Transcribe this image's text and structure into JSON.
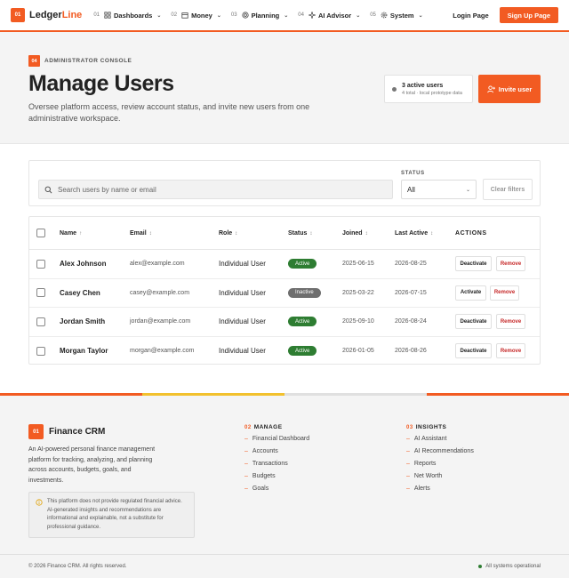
{
  "nav": {
    "logo_badge": "01",
    "logo_main": "Ledger",
    "logo_accent": "Line",
    "items": [
      {
        "num": "01",
        "label": "Dashboards",
        "icon": "grid-icon"
      },
      {
        "num": "02",
        "label": "Money",
        "icon": "calendar-icon"
      },
      {
        "num": "03",
        "label": "Planning",
        "icon": "target-icon"
      },
      {
        "num": "04",
        "label": "AI Advisor",
        "icon": "sparkle-icon"
      },
      {
        "num": "05",
        "label": "System",
        "icon": "gear-icon"
      }
    ],
    "login_label": "Login Page",
    "signup_label": "Sign Up Page"
  },
  "hero": {
    "eyebrow_badge": "04",
    "eyebrow": "ADMINISTRATOR CONSOLE",
    "title": "Manage Users",
    "subtitle": "Oversee platform access, review account status, and invite new users from one administrative workspace.",
    "stat_title": "3 active users",
    "stat_sub": "4 total · local prototype data",
    "invite_label": "Invite user"
  },
  "filters": {
    "search_placeholder": "Search users by name or email",
    "status_label": "STATUS",
    "status_value": "All",
    "clear_label": "Clear filters"
  },
  "table": {
    "headers": {
      "name": "Name",
      "email": "Email",
      "role": "Role",
      "status": "Status",
      "joined": "Joined",
      "last_active": "Last Active",
      "actions": "ACTIONS"
    },
    "rows": [
      {
        "name": "Alex Johnson",
        "email": "alex@example.com",
        "role": "Individual User",
        "status": "Active",
        "joined": "2025-06-15",
        "last_active": "2026-08-25",
        "toggle": "Deactivate",
        "remove": "Remove"
      },
      {
        "name": "Casey Chen",
        "email": "casey@example.com",
        "role": "Individual User",
        "status": "Inactive",
        "joined": "2025-03-22",
        "last_active": "2026-07-15",
        "toggle": "Activate",
        "remove": "Remove"
      },
      {
        "name": "Jordan Smith",
        "email": "jordan@example.com",
        "role": "Individual User",
        "status": "Active",
        "joined": "2025-09-10",
        "last_active": "2026-08-24",
        "toggle": "Deactivate",
        "remove": "Remove"
      },
      {
        "name": "Morgan Taylor",
        "email": "morgan@example.com",
        "role": "Individual User",
        "status": "Active",
        "joined": "2026-01-05",
        "last_active": "2026-08-26",
        "toggle": "Deactivate",
        "remove": "Remove"
      }
    ]
  },
  "colors": {
    "accent": "#f25b22",
    "active": "#2e7d32",
    "inactive": "#6e6e6e",
    "strip_yellow": "#f2c12e",
    "strip_grey": "#e0e0e0"
  },
  "footer": {
    "badge": "01",
    "brand": "Finance CRM",
    "description": "An AI-powered personal finance management platform for tracking, analyzing, and planning across accounts, budgets, goals, and investments.",
    "disclaimer": "This platform does not provide regulated financial advice. AI-generated insights and recommendations are informational and explainable, not a substitute for professional guidance.",
    "manage": {
      "num": "02",
      "title": "MANAGE",
      "links": [
        "Financial Dashboard",
        "Accounts",
        "Transactions",
        "Budgets",
        "Goals"
      ]
    },
    "insights": {
      "num": "03",
      "title": "INSIGHTS",
      "links": [
        "AI Assistant",
        "AI Recommendations",
        "Reports",
        "Net Worth",
        "Alerts"
      ]
    },
    "copyright": "© 2026 Finance CRM. All rights reserved.",
    "status": "All systems operational"
  }
}
